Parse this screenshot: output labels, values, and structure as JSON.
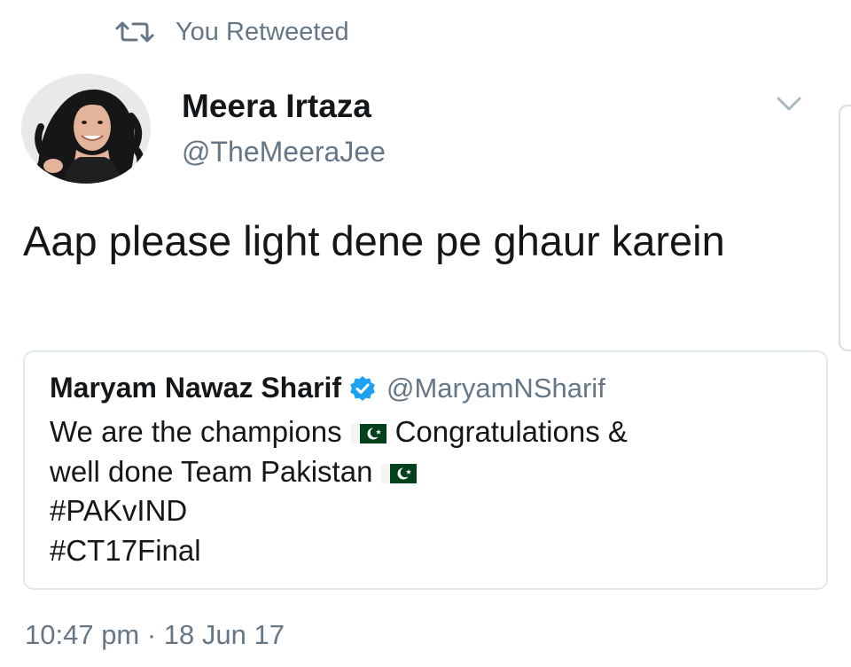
{
  "retweet": {
    "icon": "retweet-icon",
    "label": "You Retweeted"
  },
  "tweet": {
    "author": {
      "name": "Meera Irtaza",
      "handle": "@TheMeeraJee",
      "avatar": "avatar-photo"
    },
    "menu_icon": "chevron-down-icon",
    "text": "Aap please light dene pe ghaur karein",
    "timestamp": "10:47 pm · 18 Jun 17"
  },
  "quoted_tweet": {
    "author": {
      "name": "Maryam Nawaz Sharif",
      "handle": "@MaryamNSharif",
      "verified_icon": "verified-badge-icon"
    },
    "lines": [
      {
        "before": "We are the champions",
        "flag": true,
        "after": "Congratulations &"
      },
      {
        "before": "well done Team Pakistan",
        "flag": true,
        "after": ""
      },
      {
        "before": "#PAKvIND",
        "flag": false,
        "after": ""
      },
      {
        "before": "#CT17Final",
        "flag": false,
        "after": ""
      }
    ],
    "flag_icon": "pakistan-flag-icon"
  },
  "colors": {
    "text": "#14171a",
    "secondary_text": "#657786",
    "border": "#e1e8ed",
    "verified_blue": "#1da1f2",
    "flag_green": "#01411c"
  }
}
